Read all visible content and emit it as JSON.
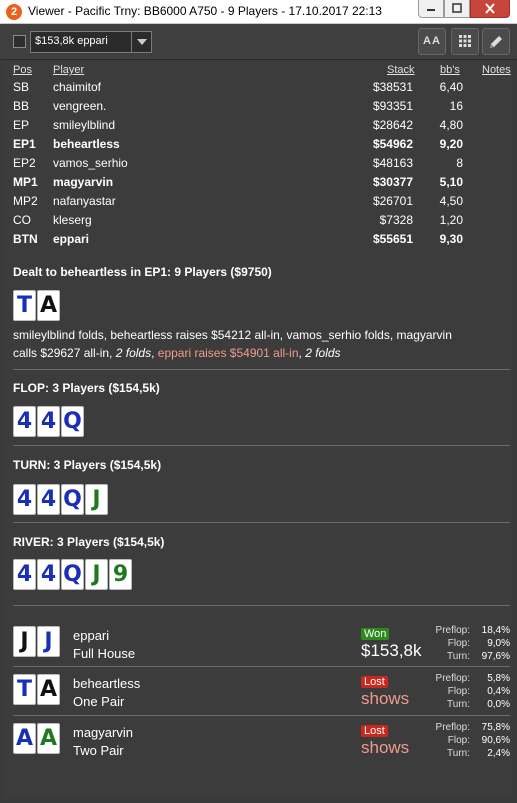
{
  "window": {
    "icon_text": "2",
    "title": "Viewer - Pacific Trny: BB6000 A750 - 9 Players - 17.10.2017 22:13"
  },
  "toolbar": {
    "player_select": "$153,8k eppari",
    "font_button": "AA"
  },
  "players": {
    "headers": {
      "pos": "Pos",
      "player": "Player",
      "stack": "Stack",
      "bbs": "bb's",
      "notes": "Notes"
    },
    "rows": [
      {
        "pos": "SB",
        "name": "chaimitof",
        "stack": "$38531",
        "bbs": "6,40",
        "bold": false
      },
      {
        "pos": "BB",
        "name": "vengreen.",
        "stack": "$93351",
        "bbs": "16",
        "bold": false
      },
      {
        "pos": "EP",
        "name": "smileylblind",
        "stack": "$28642",
        "bbs": "4,80",
        "bold": false
      },
      {
        "pos": "EP1",
        "name": "beheartless",
        "stack": "$54962",
        "bbs": "9,20",
        "bold": true
      },
      {
        "pos": "EP2",
        "name": "vamos_serhio",
        "stack": "$48163",
        "bbs": "8",
        "bold": false
      },
      {
        "pos": "MP1",
        "name": "magyarvin",
        "stack": "$30377",
        "bbs": "5,10",
        "bold": true
      },
      {
        "pos": "MP2",
        "name": "nafanyastar",
        "stack": "$26701",
        "bbs": "4,50",
        "bold": false
      },
      {
        "pos": "CO",
        "name": "kleserg",
        "stack": "$7328",
        "bbs": "1,20",
        "bold": false
      },
      {
        "pos": "BTN",
        "name": "eppari",
        "stack": "$55651",
        "bbs": "9,30",
        "bold": true
      }
    ]
  },
  "preflop": {
    "title": "Dealt to beheartless in EP1: 9 Players ($9750)",
    "cards": [
      {
        "rank": "T",
        "suit": "d"
      },
      {
        "rank": "A",
        "suit": "s"
      }
    ],
    "actions_a": "smileylblind folds, beheartless raises $54212 all-in, vamos_serhio folds, magyarvin",
    "actions_b1": "calls $29627 all-in, ",
    "actions_b2": "2 folds",
    "actions_b3": ", ",
    "actions_b4": "eppari raises $54901 all-in",
    "actions_b5": ", ",
    "actions_b6": "2 folds"
  },
  "flop": {
    "title": "FLOP: 3 Players ($154,5k)",
    "cards": [
      {
        "rank": "4",
        "suit": "d"
      },
      {
        "rank": "4",
        "suit": "d"
      },
      {
        "rank": "Q",
        "suit": "d"
      }
    ]
  },
  "turn": {
    "title": "TURN: 3 Players ($154,5k)",
    "cards": [
      {
        "rank": "4",
        "suit": "d"
      },
      {
        "rank": "4",
        "suit": "d"
      },
      {
        "rank": "Q",
        "suit": "d"
      },
      {
        "rank": "J",
        "suit": "c"
      }
    ]
  },
  "river": {
    "title": "RIVER: 3 Players ($154,5k)",
    "cards": [
      {
        "rank": "4",
        "suit": "d"
      },
      {
        "rank": "4",
        "suit": "d"
      },
      {
        "rank": "Q",
        "suit": "d"
      },
      {
        "rank": "J",
        "suit": "c"
      },
      {
        "rank": "9",
        "suit": "c"
      }
    ]
  },
  "results": [
    {
      "name": "eppari",
      "hand": "Full House",
      "cards": [
        {
          "rank": "J",
          "suit": "s"
        },
        {
          "rank": "J",
          "suit": "d"
        }
      ],
      "status": "Won",
      "status_color": "#2f8a1e",
      "amount": "$153,8k",
      "stats": [
        {
          "label": "Preflop:",
          "value": "18,4%"
        },
        {
          "label": "Flop:",
          "value": "9,0%"
        },
        {
          "label": "Turn:",
          "value": "97,6%"
        }
      ]
    },
    {
      "name": "beheartless",
      "hand": "One Pair",
      "cards": [
        {
          "rank": "T",
          "suit": "d"
        },
        {
          "rank": "A",
          "suit": "s"
        }
      ],
      "status": "Lost",
      "status_color": "#c8281e",
      "amount": "shows",
      "stats": [
        {
          "label": "Preflop:",
          "value": "5,8%"
        },
        {
          "label": "Flop:",
          "value": "0,4%"
        },
        {
          "label": "Turn:",
          "value": "0,0%"
        }
      ]
    },
    {
      "name": "magyarvin",
      "hand": "Two Pair",
      "cards": [
        {
          "rank": "A",
          "suit": "d"
        },
        {
          "rank": "A",
          "suit": "c"
        }
      ],
      "status": "Lost",
      "status_color": "#c8281e",
      "amount": "shows",
      "stats": [
        {
          "label": "Preflop:",
          "value": "75,8%"
        },
        {
          "label": "Flop:",
          "value": "90,6%"
        },
        {
          "label": "Turn:",
          "value": "2,4%"
        }
      ]
    }
  ]
}
